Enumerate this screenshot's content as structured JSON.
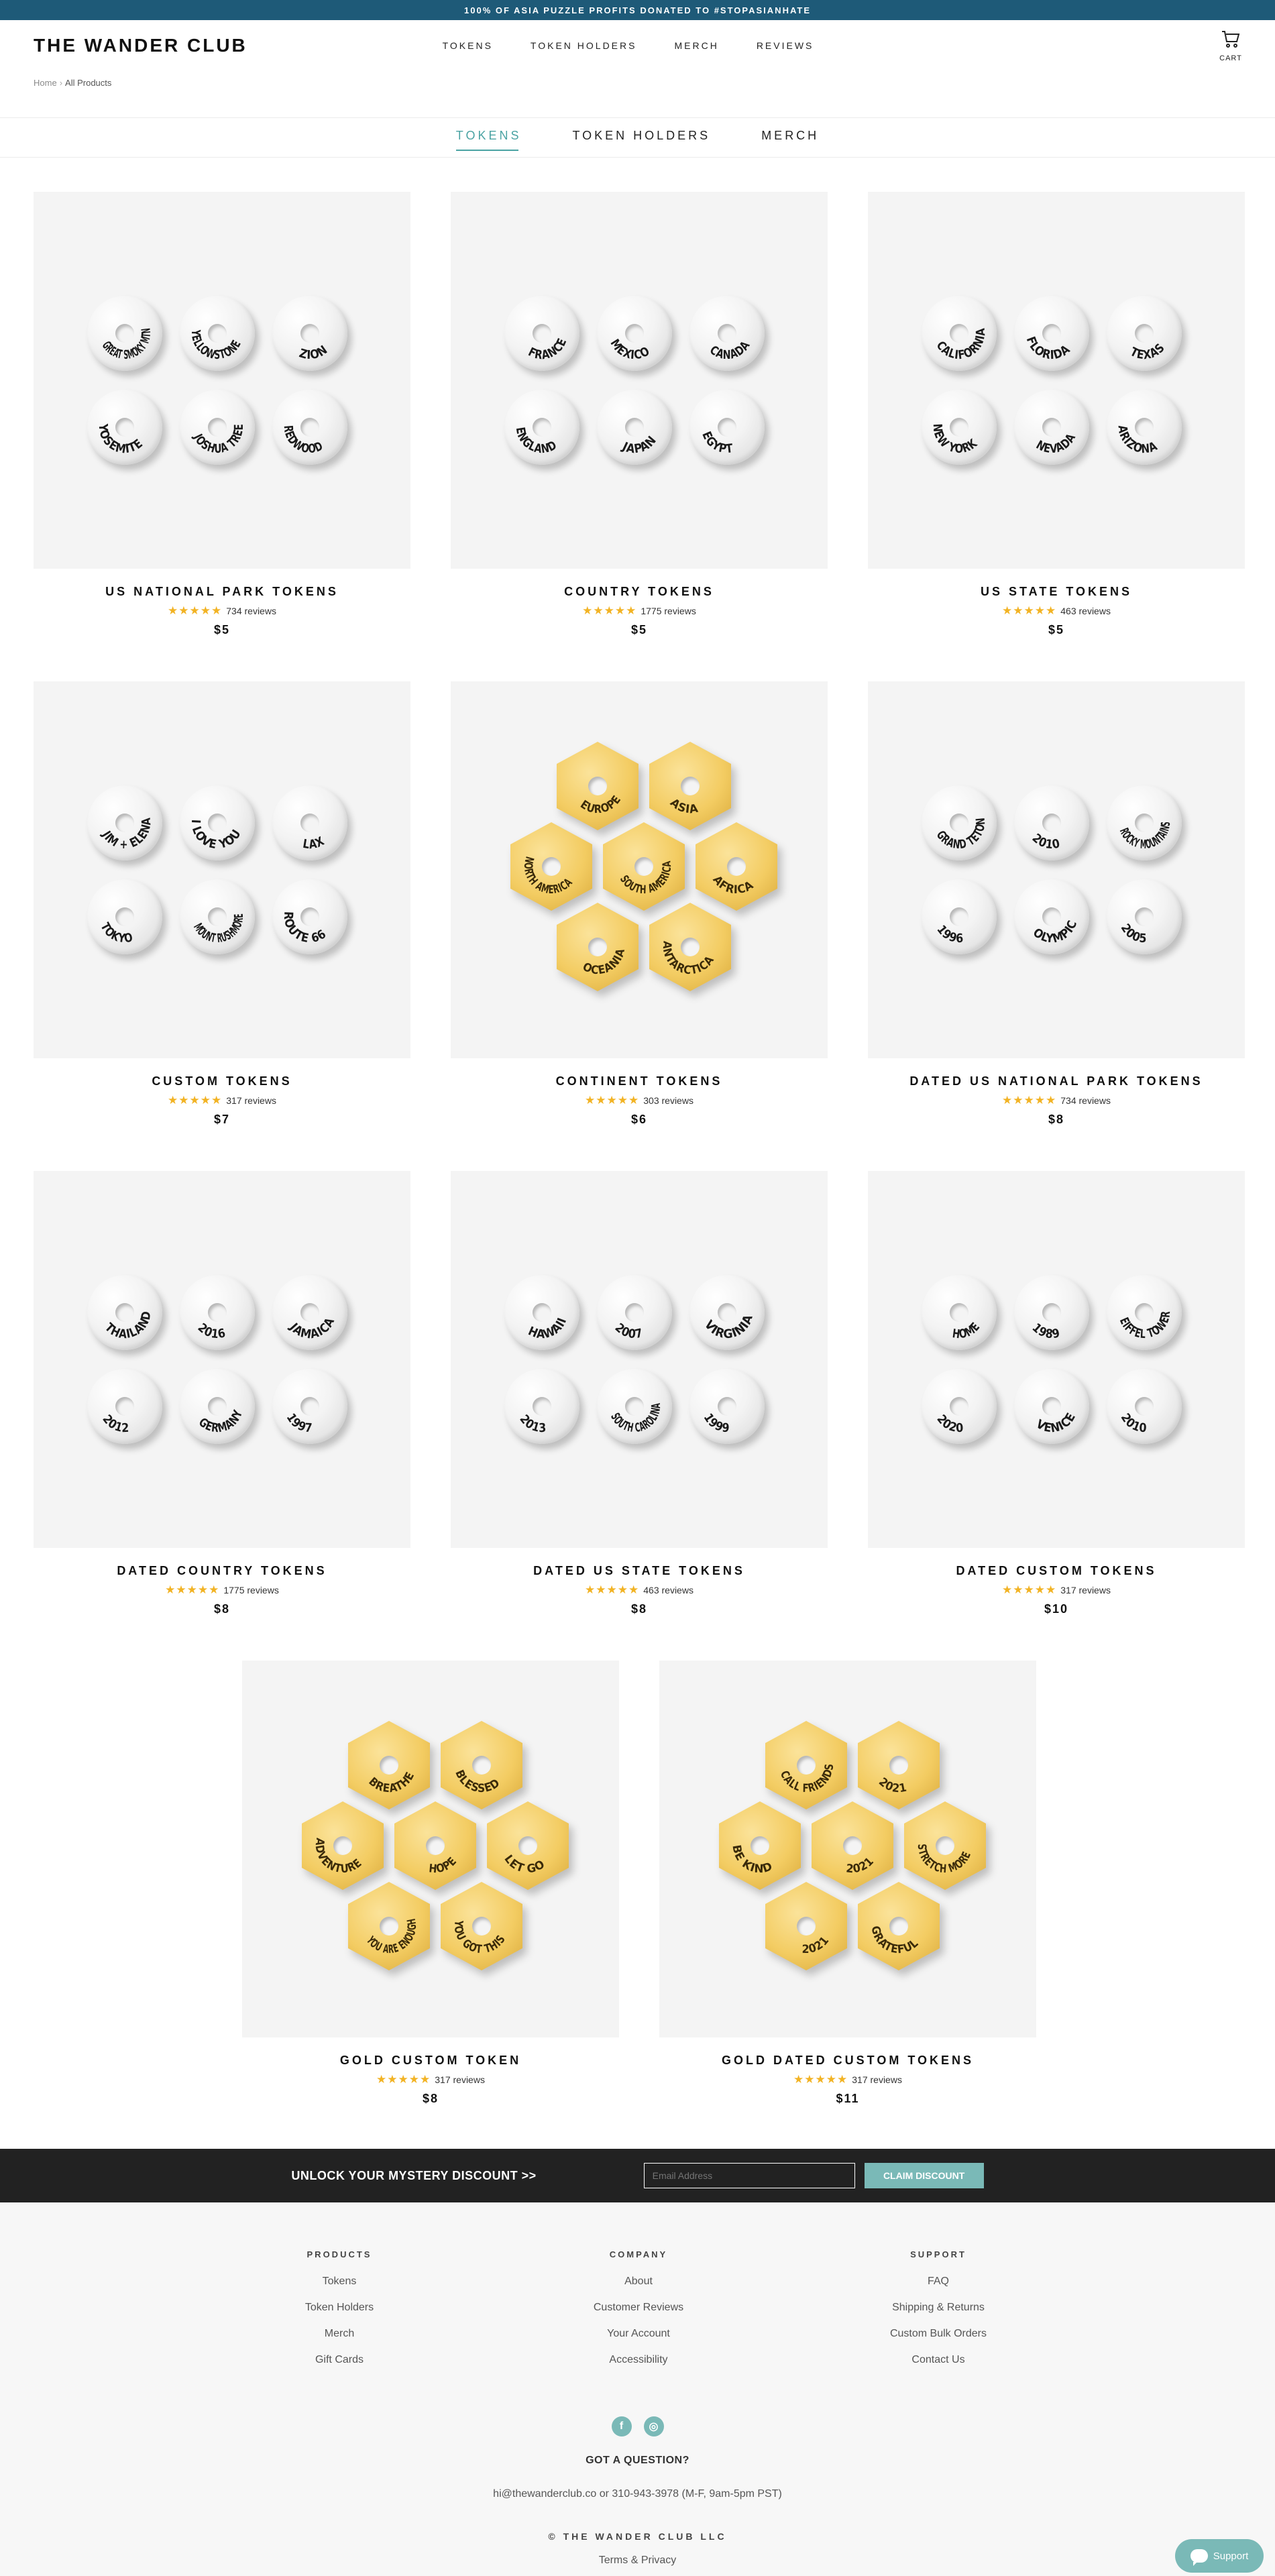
{
  "announcement": "100% OF ASIA PUZZLE PROFITS DONATED TO #STOPASIANHATE",
  "header": {
    "logo": "THE WANDER CLUB",
    "nav": [
      "TOKENS",
      "TOKEN HOLDERS",
      "MERCH",
      "REVIEWS"
    ],
    "cart_label": "CART"
  },
  "breadcrumb": {
    "home": "Home",
    "sep": "›",
    "current": "All Products"
  },
  "subnav": {
    "items": [
      "TOKENS",
      "TOKEN HOLDERS",
      "MERCH"
    ],
    "active": "TOKENS"
  },
  "star_glyphs": "★★★★★",
  "colors": {
    "accent": "#4aa3a3",
    "announcement_bg": "#1e5a78",
    "star": "#f2b324",
    "promo_bg": "#222222",
    "claim_bg": "#7ab9b7"
  },
  "products": [
    {
      "title": "US NATIONAL PARK TOKENS",
      "reviews": "734 reviews",
      "price": "$5",
      "style": "silver",
      "tokens": [
        "GREAT SMOKY MTN",
        "YELLOWSTONE",
        "ZION",
        "YOSEMITE",
        "JOSHUA TREE",
        "REDWOOD"
      ]
    },
    {
      "title": "COUNTRY TOKENS",
      "reviews": "1775 reviews",
      "price": "$5",
      "style": "silver",
      "tokens": [
        "FRANCE",
        "MEXICO",
        "CANADA",
        "ENGLAND",
        "JAPAN",
        "EGYPT"
      ]
    },
    {
      "title": "US STATE TOKENS",
      "reviews": "463 reviews",
      "price": "$5",
      "style": "silver",
      "tokens": [
        "CALIFORNIA",
        "FLORIDA",
        "TEXAS",
        "NEW YORK",
        "NEVADA",
        "ARIZONA"
      ]
    },
    {
      "title": "CUSTOM TOKENS",
      "reviews": "317 reviews",
      "price": "$7",
      "style": "silver",
      "tokens": [
        "JIM + ELENA",
        "I LOVE YOU",
        "LAX",
        "TOKYO",
        "MOUNT RUSHMORE",
        "ROUTE 66"
      ]
    },
    {
      "title": "CONTINENT TOKENS",
      "reviews": "303 reviews",
      "price": "$6",
      "style": "gold",
      "tokens": [
        "EUROPE",
        "ASIA",
        "NORTH AMERICA",
        "SOUTH AMERICA",
        "AFRICA",
        "OCEANIA",
        "ANTARCTICA"
      ]
    },
    {
      "title": "DATED US NATIONAL PARK TOKENS",
      "reviews": "734 reviews",
      "price": "$8",
      "style": "silver",
      "tokens": [
        "GRAND TETON",
        "2010",
        "ROCKY MOUNTAINS",
        "1996",
        "OLYMPIC",
        "2005"
      ]
    },
    {
      "title": "DATED COUNTRY TOKENS",
      "reviews": "1775 reviews",
      "price": "$8",
      "style": "silver",
      "tokens": [
        "THAILAND",
        "2016",
        "JAMAICA",
        "2012",
        "GERMANY",
        "1997"
      ]
    },
    {
      "title": "DATED US STATE TOKENS",
      "reviews": "463 reviews",
      "price": "$8",
      "style": "silver",
      "tokens": [
        "HAWAII",
        "2007",
        "VIRGINIA",
        "2013",
        "SOUTH CAROLINA",
        "1999"
      ]
    },
    {
      "title": "DATED CUSTOM TOKENS",
      "reviews": "317 reviews",
      "price": "$10",
      "style": "silver",
      "tokens": [
        "HOME",
        "1989",
        "EIFFEL TOWER",
        "2020",
        "VENICE",
        "2010"
      ]
    },
    {
      "title": "GOLD CUSTOM TOKEN",
      "reviews": "317 reviews",
      "price": "$8",
      "style": "gold",
      "tokens": [
        "BREATHE",
        "BLESSED",
        "ADVENTURE",
        "HOPE",
        "LET GO",
        "YOU ARE ENOUGH",
        "YOU GOT THIS"
      ]
    },
    {
      "title": "GOLD DATED CUSTOM TOKENS",
      "reviews": "317 reviews",
      "price": "$11",
      "style": "gold",
      "tokens": [
        "CALL FRIENDS",
        "2021",
        "BE KIND",
        "2021",
        "STRETCH MORE",
        "2021",
        "GRATEFUL"
      ]
    }
  ],
  "promo": {
    "title": "UNLOCK YOUR MYSTERY DISCOUNT >>",
    "email_placeholder": "Email Address",
    "button": "CLAIM DISCOUNT"
  },
  "footer": {
    "columns": [
      {
        "heading": "PRODUCTS",
        "links": [
          "Tokens",
          "Token Holders",
          "Merch",
          "Gift Cards"
        ]
      },
      {
        "heading": "COMPANY",
        "links": [
          "About",
          "Customer Reviews",
          "Your Account",
          "Accessibility"
        ]
      },
      {
        "heading": "SUPPORT",
        "links": [
          "FAQ",
          "Shipping & Returns",
          "Custom Bulk Orders",
          "Contact Us"
        ]
      }
    ],
    "social_icons": [
      "facebook-icon",
      "instagram-icon"
    ],
    "question": "GOT A QUESTION?",
    "contact": "hi@thewanderclub.co or 310-943-3978 (M-F, 9am-5pm PST)",
    "copyright": "© THE WANDER CLUB LLC",
    "terms": "Terms & Privacy"
  },
  "support_label": "Support"
}
